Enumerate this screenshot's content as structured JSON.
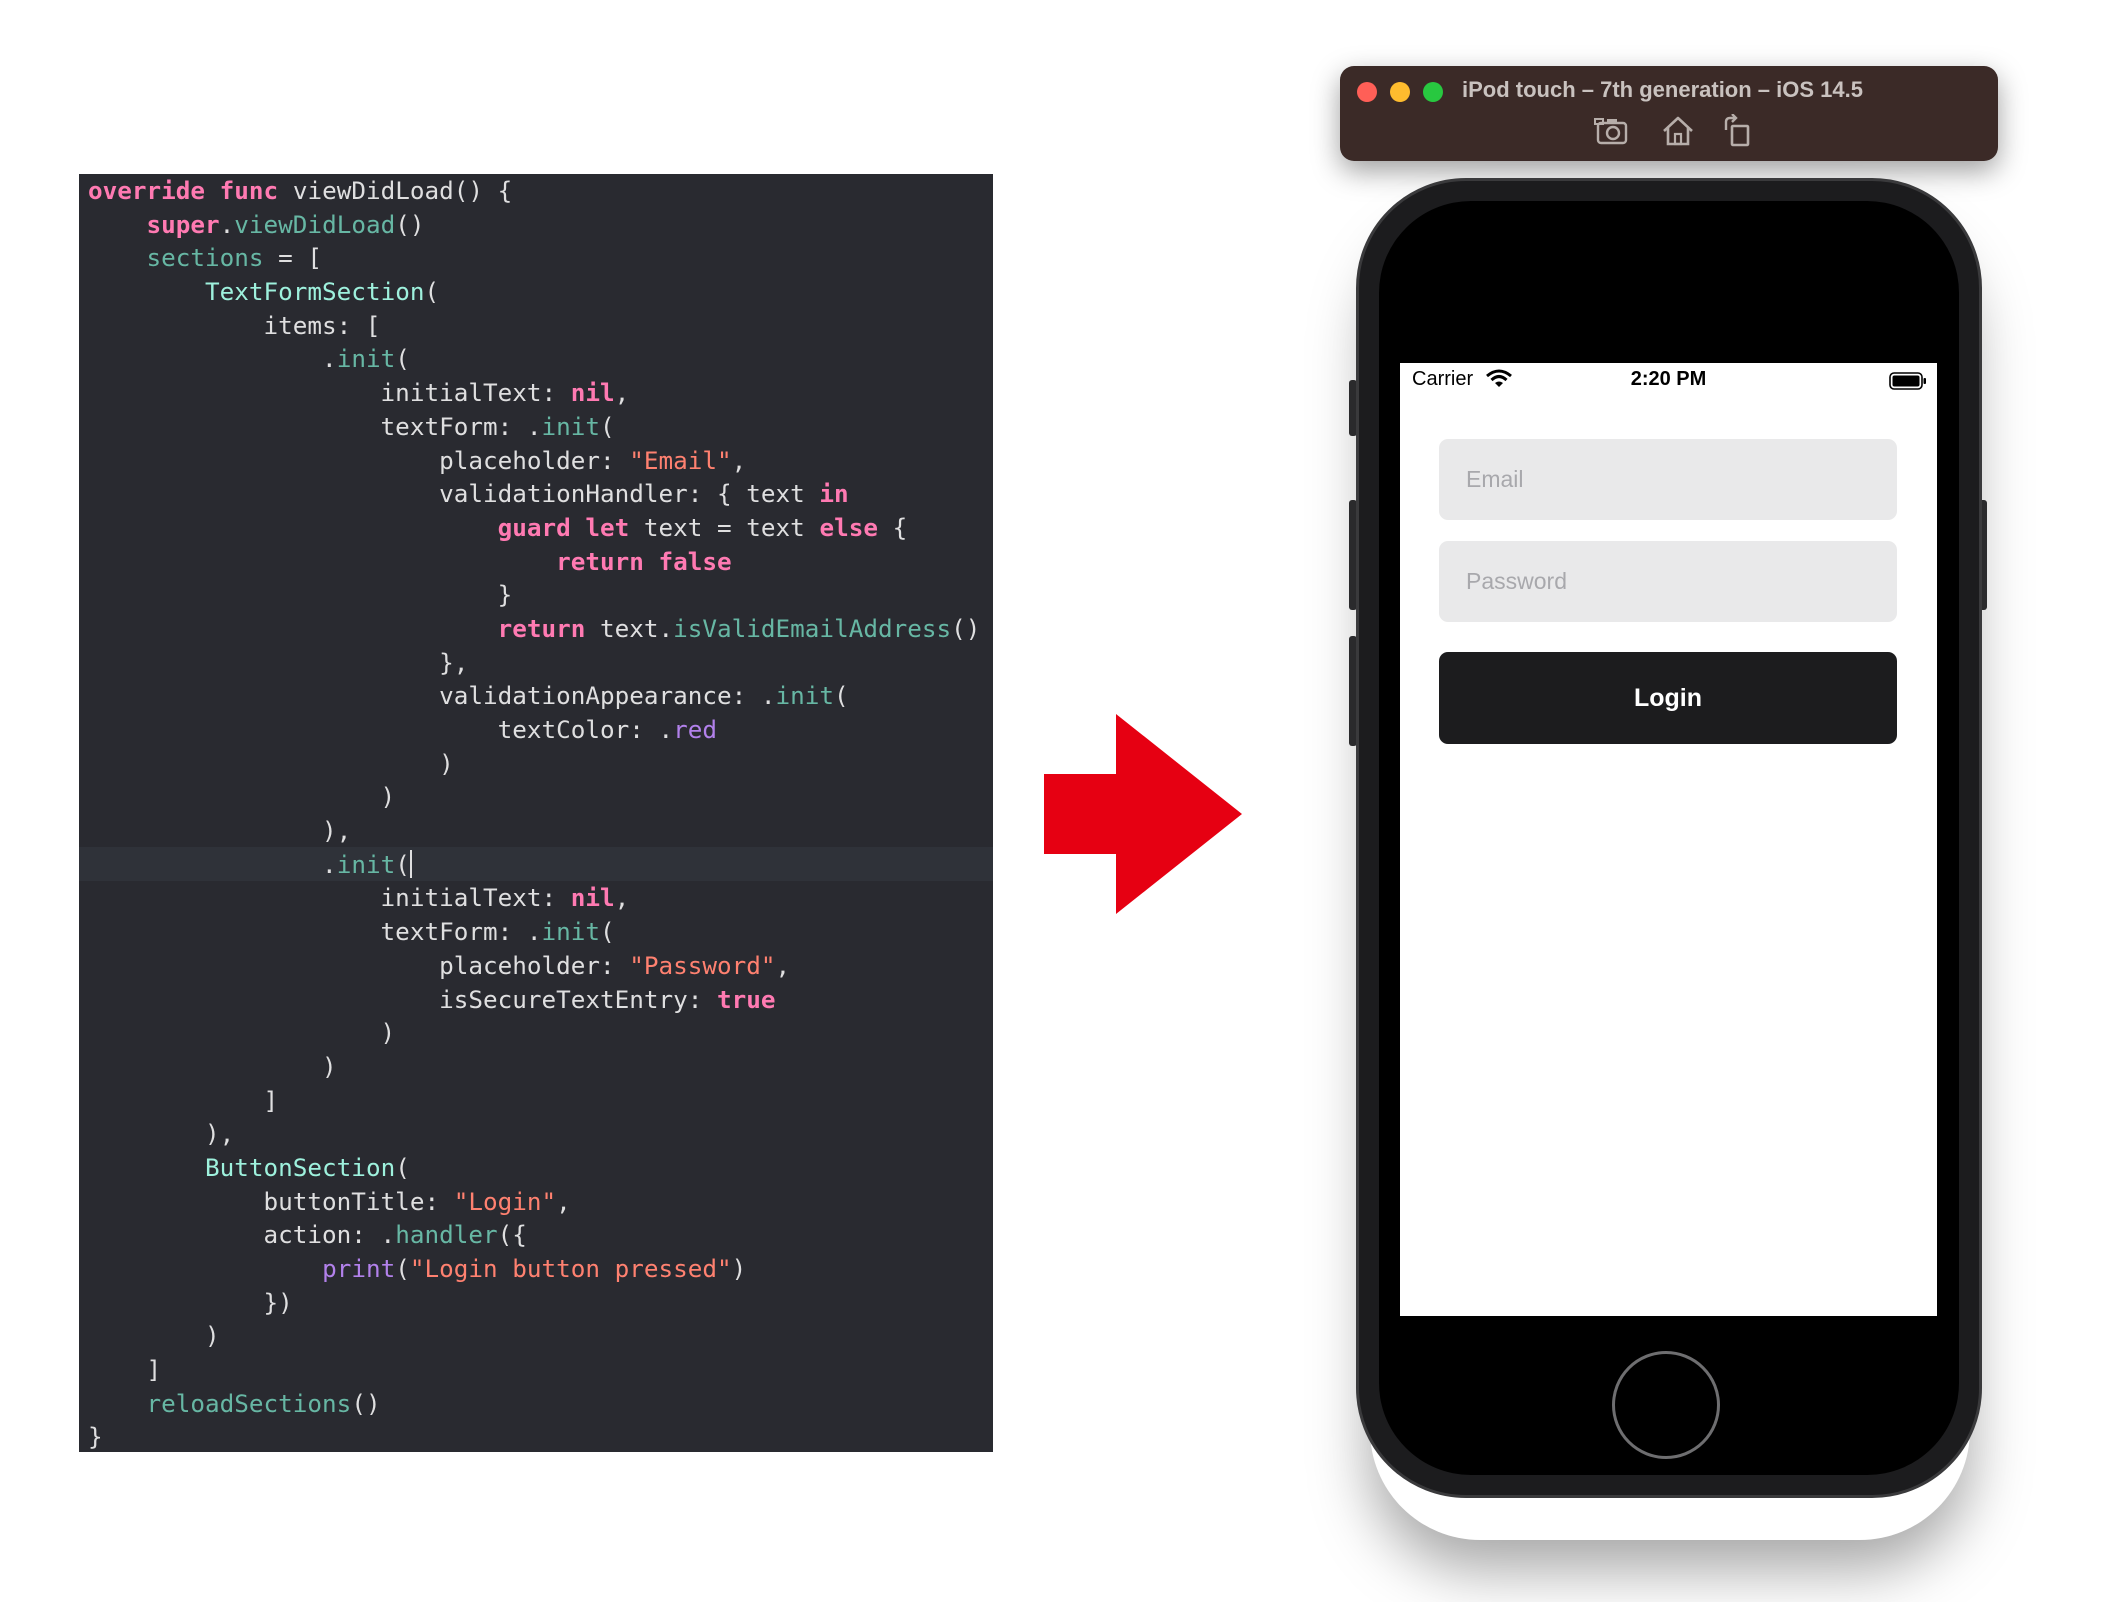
{
  "code": {
    "lines": [
      [
        {
          "t": "override",
          "c": "kw"
        },
        {
          "t": " "
        },
        {
          "t": "func",
          "c": "kw"
        },
        {
          "t": " viewDidLoad() {"
        }
      ],
      [
        {
          "t": "    "
        },
        {
          "t": "super",
          "c": "kw"
        },
        {
          "t": "."
        },
        {
          "t": "viewDidLoad",
          "c": "call"
        },
        {
          "t": "()"
        }
      ],
      [
        {
          "t": "    "
        },
        {
          "t": "sections",
          "c": "call"
        },
        {
          "t": " = ["
        }
      ],
      [
        {
          "t": "        "
        },
        {
          "t": "TextFormSection",
          "c": "type"
        },
        {
          "t": "("
        }
      ],
      [
        {
          "t": "            items: ["
        }
      ],
      [
        {
          "t": "                ."
        },
        {
          "t": "init",
          "c": "call"
        },
        {
          "t": "("
        }
      ],
      [
        {
          "t": "                    initialText: "
        },
        {
          "t": "nil",
          "c": "kw"
        },
        {
          "t": ","
        }
      ],
      [
        {
          "t": "                    textForm: ."
        },
        {
          "t": "init",
          "c": "call"
        },
        {
          "t": "("
        }
      ],
      [
        {
          "t": "                        placeholder: "
        },
        {
          "t": "\"Email\"",
          "c": "str"
        },
        {
          "t": ","
        }
      ],
      [
        {
          "t": "                        validationHandler: { text "
        },
        {
          "t": "in",
          "c": "kw"
        }
      ],
      [
        {
          "t": "                            "
        },
        {
          "t": "guard",
          "c": "kw"
        },
        {
          "t": " "
        },
        {
          "t": "let",
          "c": "kw"
        },
        {
          "t": " text = text "
        },
        {
          "t": "else",
          "c": "kw"
        },
        {
          "t": " {"
        }
      ],
      [
        {
          "t": "                                "
        },
        {
          "t": "return",
          "c": "kw"
        },
        {
          "t": " "
        },
        {
          "t": "false",
          "c": "kw"
        }
      ],
      [
        {
          "t": "                            }"
        }
      ],
      [
        {
          "t": "                            "
        },
        {
          "t": "return",
          "c": "kw"
        },
        {
          "t": " text."
        },
        {
          "t": "isValidEmailAddress",
          "c": "call"
        },
        {
          "t": "()"
        }
      ],
      [
        {
          "t": "                        },"
        }
      ],
      [
        {
          "t": "                        validationAppearance: ."
        },
        {
          "t": "init",
          "c": "call"
        },
        {
          "t": "("
        }
      ],
      [
        {
          "t": "                            textColor: ."
        },
        {
          "t": "red",
          "c": "purple"
        }
      ],
      [
        {
          "t": "                        )"
        }
      ],
      [
        {
          "t": "                    )"
        }
      ],
      [
        {
          "t": "                ),"
        }
      ],
      [
        {
          "t": "                ."
        },
        {
          "t": "init",
          "c": "call"
        },
        {
          "t": "("
        },
        {
          "t": "",
          "c": "caret"
        }
      ],
      [
        {
          "t": "                    initialText: "
        },
        {
          "t": "nil",
          "c": "kw"
        },
        {
          "t": ","
        }
      ],
      [
        {
          "t": "                    textForm: ."
        },
        {
          "t": "init",
          "c": "call"
        },
        {
          "t": "("
        }
      ],
      [
        {
          "t": "                        placeholder: "
        },
        {
          "t": "\"Password\"",
          "c": "str"
        },
        {
          "t": ","
        }
      ],
      [
        {
          "t": "                        isSecureTextEntry: "
        },
        {
          "t": "true",
          "c": "kw"
        }
      ],
      [
        {
          "t": "                    )"
        }
      ],
      [
        {
          "t": "                )"
        }
      ],
      [
        {
          "t": "            ]"
        }
      ],
      [
        {
          "t": "        ),"
        }
      ],
      [
        {
          "t": "        "
        },
        {
          "t": "ButtonSection",
          "c": "type"
        },
        {
          "t": "("
        }
      ],
      [
        {
          "t": "            buttonTitle: "
        },
        {
          "t": "\"Login\"",
          "c": "str"
        },
        {
          "t": ","
        }
      ],
      [
        {
          "t": "            action: ."
        },
        {
          "t": "handler",
          "c": "call"
        },
        {
          "t": "({"
        }
      ],
      [
        {
          "t": "                "
        },
        {
          "t": "print",
          "c": "purple"
        },
        {
          "t": "("
        },
        {
          "t": "\"Login button pressed\"",
          "c": "str"
        },
        {
          "t": ")"
        }
      ],
      [
        {
          "t": "            })"
        }
      ],
      [
        {
          "t": "        )"
        }
      ],
      [
        {
          "t": "    ]"
        }
      ],
      [
        {
          "t": "    "
        },
        {
          "t": "reloadSections",
          "c": "call"
        },
        {
          "t": "()"
        }
      ],
      [
        {
          "t": "}"
        }
      ]
    ],
    "highlighted_line_index": 20
  },
  "simulator": {
    "title": "iPod touch – 7th generation – iOS 14.5",
    "toolbar_icons": [
      "screenshot-icon",
      "home-icon",
      "rotate-icon"
    ]
  },
  "phone": {
    "status_bar": {
      "carrier": "Carrier",
      "time": "2:20 PM"
    },
    "form": {
      "email_placeholder": "Email",
      "password_placeholder": "Password",
      "login_label": "Login"
    }
  },
  "colors": {
    "editor_background": "#292a30",
    "keyword": "#ff7ab2",
    "string": "#ff8170",
    "type": "#9ef1dd",
    "call": "#67b7a4",
    "arrow": "#e60012",
    "login_button": "#1c1c1e",
    "field_background": "#e9e9ea"
  }
}
